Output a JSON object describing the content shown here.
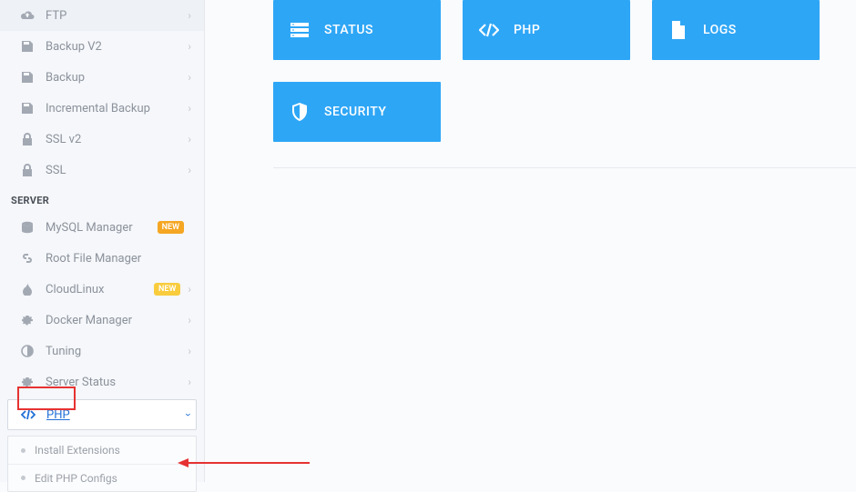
{
  "sidebar": {
    "group_top": [
      {
        "label": "FTP",
        "icon": "cloud"
      },
      {
        "label": "Backup V2",
        "icon": "save"
      },
      {
        "label": "Backup",
        "icon": "save"
      },
      {
        "label": "Incremental Backup",
        "icon": "save"
      },
      {
        "label": "SSL v2",
        "icon": "lock"
      },
      {
        "label": "SSL",
        "icon": "lock"
      }
    ],
    "section_label": "SERVER",
    "group_server": [
      {
        "label": "MySQL Manager",
        "icon": "database",
        "badge": "NEW",
        "badge_color": "orange"
      },
      {
        "label": "Root File Manager",
        "icon": "link"
      },
      {
        "label": "CloudLinux",
        "icon": "flame",
        "badge": "NEW",
        "badge_color": "yellow",
        "chevron": true
      },
      {
        "label": "Docker Manager",
        "icon": "gear",
        "chevron": true
      },
      {
        "label": "Tuning",
        "icon": "contrast",
        "chevron": true
      },
      {
        "label": "Server Status",
        "icon": "gear",
        "chevron": true
      }
    ],
    "active_item": {
      "label": "PHP",
      "icon": "code"
    },
    "sub_items": [
      {
        "label": "Install Extensions"
      },
      {
        "label": "Edit PHP Configs"
      }
    ]
  },
  "tiles": [
    {
      "label": "STATUS",
      "icon": "bars"
    },
    {
      "label": "PHP",
      "icon": "code"
    },
    {
      "label": "LOGS",
      "icon": "file"
    },
    {
      "label": "SECURITY",
      "icon": "shield"
    }
  ],
  "colors": {
    "tile_bg": "#2ea6f6",
    "highlight_red": "#e63232"
  }
}
